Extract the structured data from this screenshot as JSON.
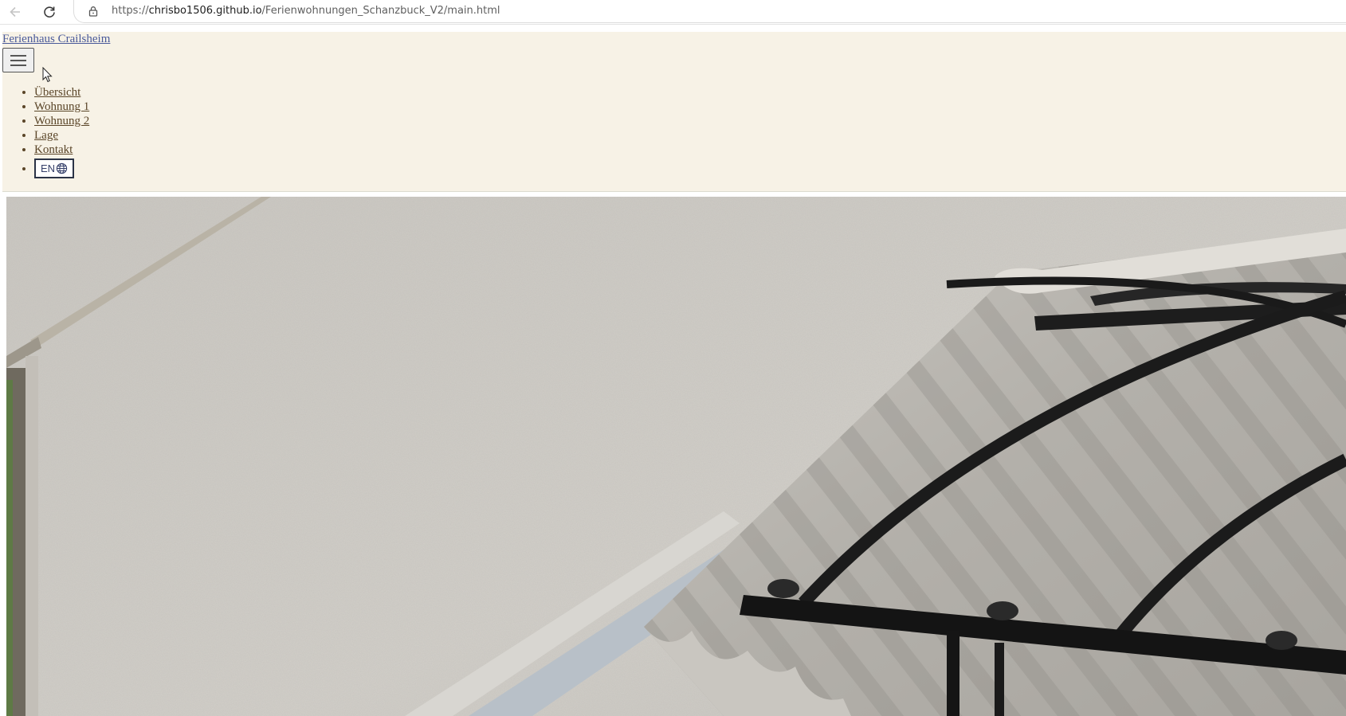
{
  "browser": {
    "url_prefix": "https://",
    "url_host": "chrisbo1506.github.io",
    "url_path": "/Ferienwohnungen_Schanzbuck_V2/main.html"
  },
  "header": {
    "brand": "Ferienhaus Crailsheim",
    "nav_items": [
      "Übersicht",
      "Wohnung 1",
      "Wohnung 2",
      "Lage",
      "Kontakt"
    ],
    "lang_label": "EN"
  },
  "icons": {
    "back": "arrow-left-icon",
    "reload": "reload-icon",
    "lock": "lock-icon",
    "menu": "hamburger-icon",
    "language": "globe-icon"
  },
  "colors": {
    "header_bg": "#f7f2e6",
    "brand_link": "#4a5a9a",
    "nav_link": "#5a4528"
  }
}
